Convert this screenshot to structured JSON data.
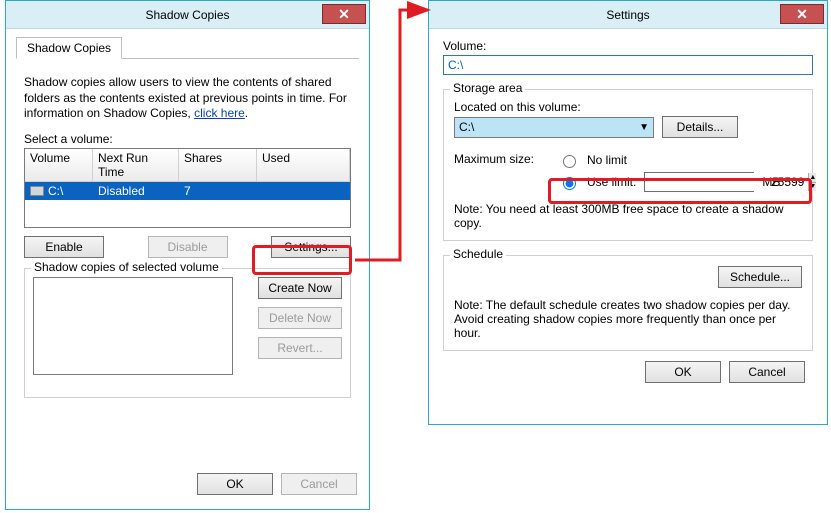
{
  "left": {
    "title": "Shadow Copies",
    "tab": "Shadow Copies",
    "desc_line1": "Shadow copies allow users to view the contents of shared folders as the contents existed at previous points in time. For information on Shadow Copies, ",
    "link": "click here",
    "select_label": "Select a volume:",
    "cols": {
      "vol": "Volume",
      "next": "Next Run Time",
      "shares": "Shares",
      "used": "Used"
    },
    "row": {
      "vol": "C:\\",
      "next": "Disabled",
      "shares": "7",
      "used": ""
    },
    "btn_enable": "Enable",
    "btn_disable": "Disable",
    "btn_settings": "Settings...",
    "group_title": "Shadow copies of selected volume",
    "btn_create": "Create Now",
    "btn_delete": "Delete Now",
    "btn_revert": "Revert...",
    "ok": "OK",
    "cancel": "Cancel"
  },
  "right": {
    "title": "Settings",
    "volume_label": "Volume:",
    "volume_value": "C:\\",
    "storage_title": "Storage area",
    "located_label": "Located on this volume:",
    "located_value": "C:\\",
    "details": "Details...",
    "max_label": "Maximum size:",
    "radio_nolimit": "No limit",
    "radio_uselimit": "Use limit:",
    "limit_value": "25599",
    "unit": "MB",
    "note1": "Note: You need at least 300MB free space to create a shadow copy.",
    "schedule_title": "Schedule",
    "schedule_btn": "Schedule...",
    "note2": "Note: The default schedule creates two shadow copies per day. Avoid creating shadow copies more frequently than once per hour.",
    "ok": "OK",
    "cancel": "Cancel"
  }
}
